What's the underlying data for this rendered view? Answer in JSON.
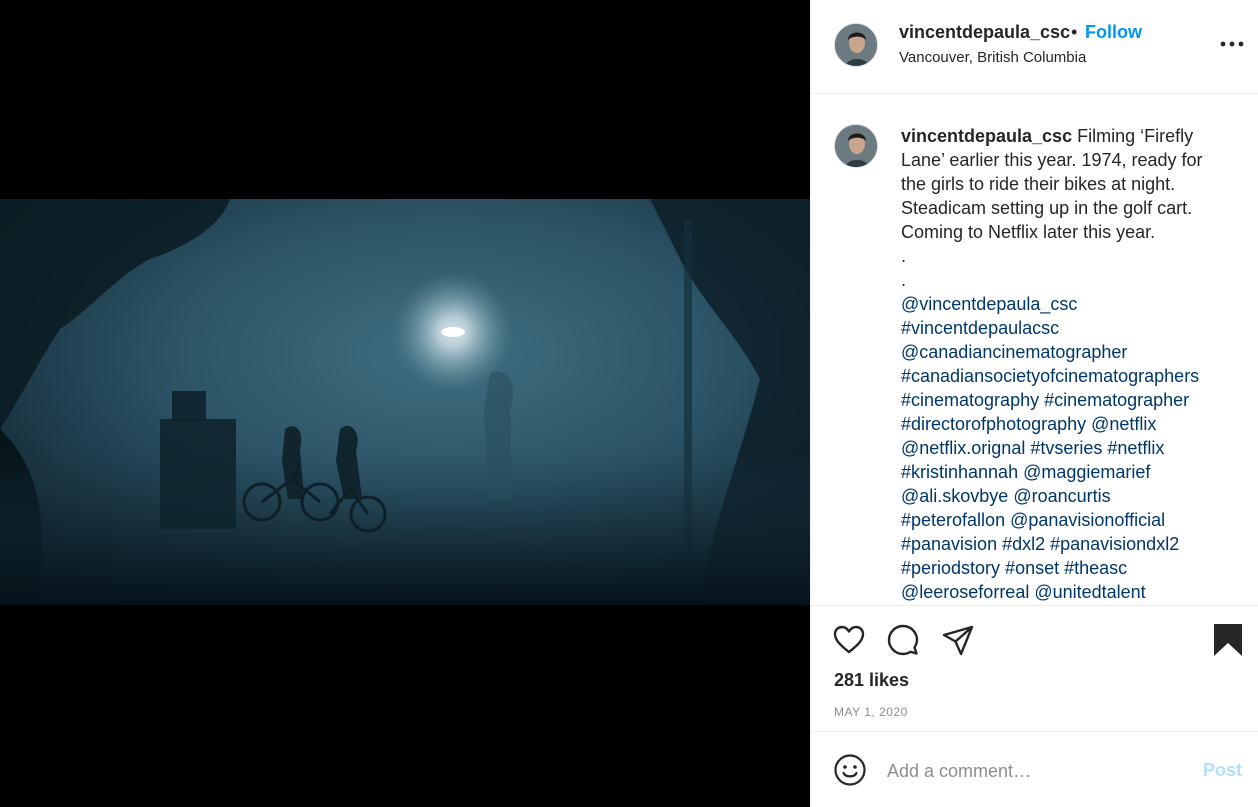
{
  "header": {
    "username": "vincentdepaula_csc",
    "separator": "•",
    "follow_label": "Follow",
    "location": "Vancouver, British Columbia",
    "more_icon": "more-horizontal-icon"
  },
  "caption": {
    "username": "vincentdepaula_csc",
    "text": "Filming ‘Firefly Lane’ earlier this year. 1974, ready for the girls to ride their bikes at night. Steadicam setting up in the golf cart. Coming to Netflix later this year.",
    "dot1": ".",
    "dot2": ".",
    "tag_lines": [
      "@vincentdepaula_csc",
      "#vincentdepaulacsc",
      "@canadiancinematographer",
      "#canadiansocietyofcinematographers",
      "#cinematography #cinematographer",
      "#directorofphotography @netflix",
      "@netflix.orignal #tvseries #netflix",
      "#kristinhannah @maggiemarief",
      "@ali.skovbye @roancurtis",
      "#peterofallon @panavisionofficial",
      "#panavision #dxl2 #panavisiondxl2",
      "#periodstory #onset #theasc",
      "@leeroseforreal @unitedtalent"
    ]
  },
  "actions": {
    "icons": [
      "heart-icon",
      "comment-icon",
      "share-icon",
      "bookmark-icon"
    ],
    "likes": "281 likes",
    "date": "MAY 1, 2020"
  },
  "add_comment": {
    "placeholder": "Add a comment…",
    "post_label": "Post"
  },
  "colors": {
    "follow": "#0095f6",
    "hashtag": "#00376b",
    "post_disabled": "#b2dffc",
    "muted": "#8e8e8e"
  }
}
